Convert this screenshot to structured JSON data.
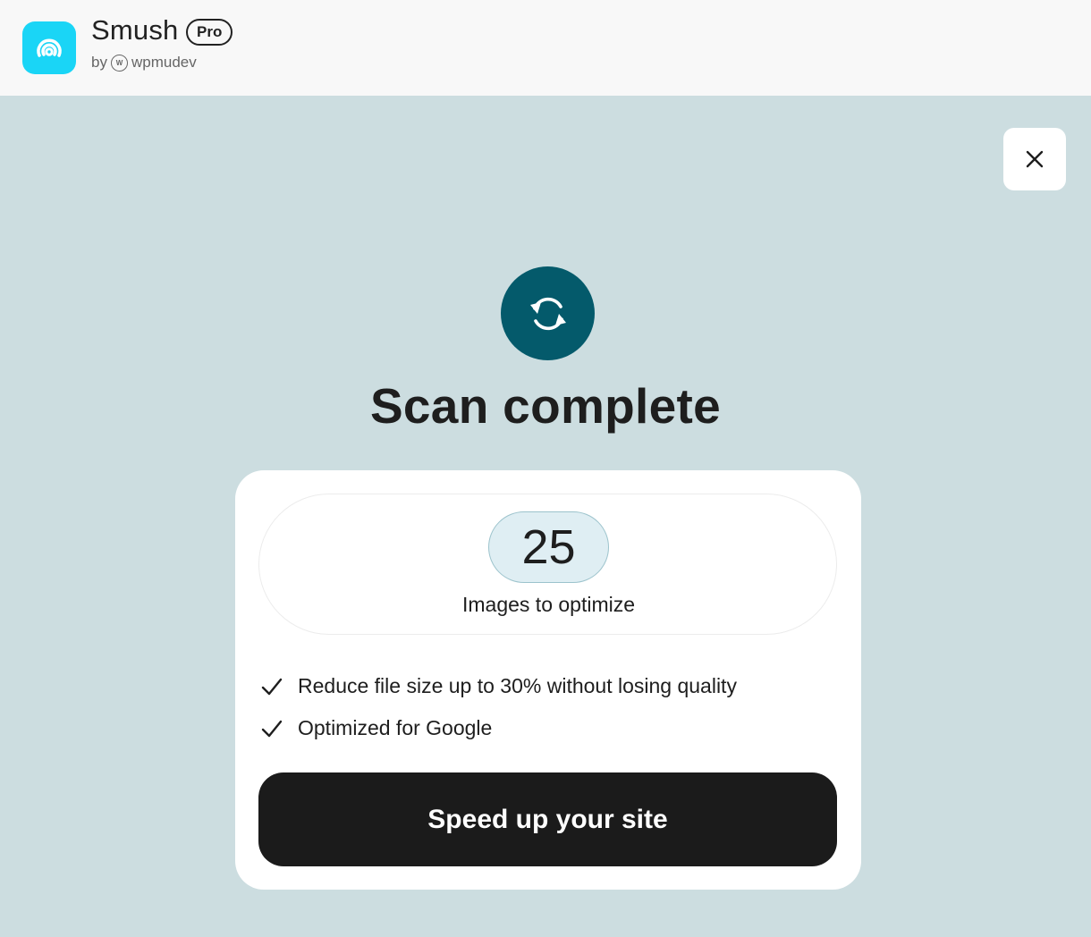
{
  "app": {
    "name": "Smush",
    "badge": "Pro",
    "by": "by",
    "vendor": "wpmudev",
    "vendor_icon_label": "W",
    "logo_color": "#1ad5f6"
  },
  "close": {
    "icon": "close-icon"
  },
  "status": {
    "icon": "sync-icon",
    "icon_color": "#045a6b",
    "title": "Scan complete"
  },
  "summary": {
    "count": "25",
    "count_label": "Images to optimize"
  },
  "benefits": [
    {
      "icon": "check-icon",
      "text": "Reduce file size up to 30% without losing quality"
    },
    {
      "icon": "check-icon",
      "text": "Optimized for Google"
    }
  ],
  "cta": {
    "label": "Speed up your site"
  }
}
